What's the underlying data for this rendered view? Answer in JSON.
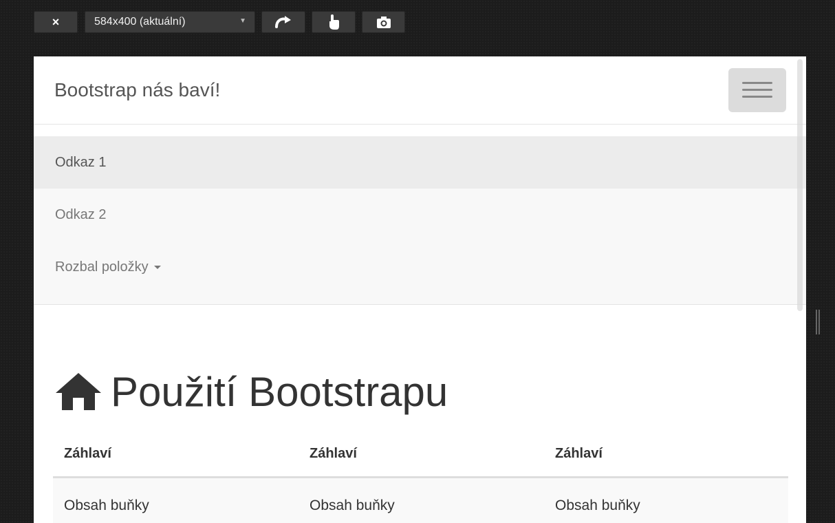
{
  "toolbar": {
    "close_label": "×",
    "size_select": "584x400 (aktuální)"
  },
  "navbar": {
    "brand": "Bootstrap nás baví!",
    "menu_items": [
      {
        "label": "Odkaz 1",
        "active": true
      },
      {
        "label": "Odkaz 2",
        "active": false
      },
      {
        "label": "Rozbal položky",
        "active": false,
        "dropdown": true
      }
    ]
  },
  "main": {
    "heading": "Použití Bootstrapu",
    "heading_icon": "home-icon",
    "table": {
      "headers": [
        "Záhlaví",
        "Záhlaví",
        "Záhlaví"
      ],
      "rows": [
        [
          "Obsah buňky",
          "Obsah buňky",
          "Obsah buňky"
        ]
      ]
    }
  },
  "colors": {
    "page_bg": "#1c1c1c",
    "toolbar_button": "#3a3a3a",
    "navbar_bg": "#ffffff",
    "collapse_bg": "#f8f8f8",
    "active_item_bg": "#ececec",
    "text": "#333333"
  }
}
